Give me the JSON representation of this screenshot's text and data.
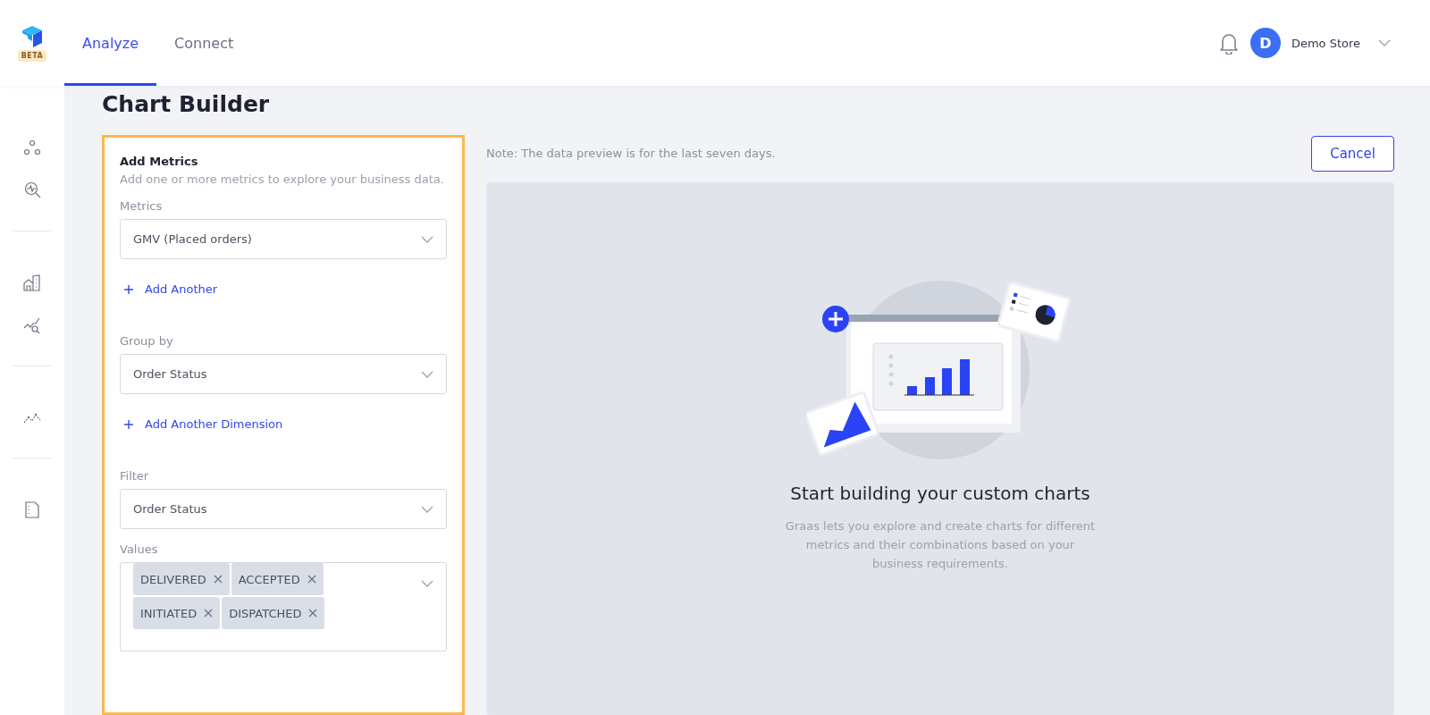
{
  "header": {
    "logo_badge": "BETA",
    "tabs": [
      {
        "label": "Analyze",
        "selected": true
      },
      {
        "label": "Connect",
        "selected": false
      }
    ],
    "user": {
      "initial": "D",
      "name": "Demo Store"
    }
  },
  "page_title": "Chart Builder",
  "builder": {
    "title": "Add Metrics",
    "description": "Add one or more metrics to explore your business data.",
    "fields": [
      {
        "kind": "select",
        "label": "Metrics",
        "value": "GMV (Placed orders)"
      },
      {
        "kind": "add",
        "label": "Add Another"
      },
      {
        "kind": "select",
        "label": "Group by",
        "value": "Order Status"
      },
      {
        "kind": "add",
        "label": "Add Another Dimension"
      },
      {
        "kind": "select",
        "label": "Filter",
        "value": "Order Status"
      },
      {
        "kind": "tags",
        "label": "Values",
        "tags": [
          "DELIVERED",
          "ACCEPTED",
          "INITIATED",
          "DISPATCHED"
        ]
      }
    ]
  },
  "preview": {
    "note": "Note: The data preview is for the last seven days.",
    "cancel": "Cancel",
    "empty_title": "Start building your custom charts",
    "empty_text": "Graas lets you explore and create charts for different metrics and their combinations based on your business requirements."
  }
}
